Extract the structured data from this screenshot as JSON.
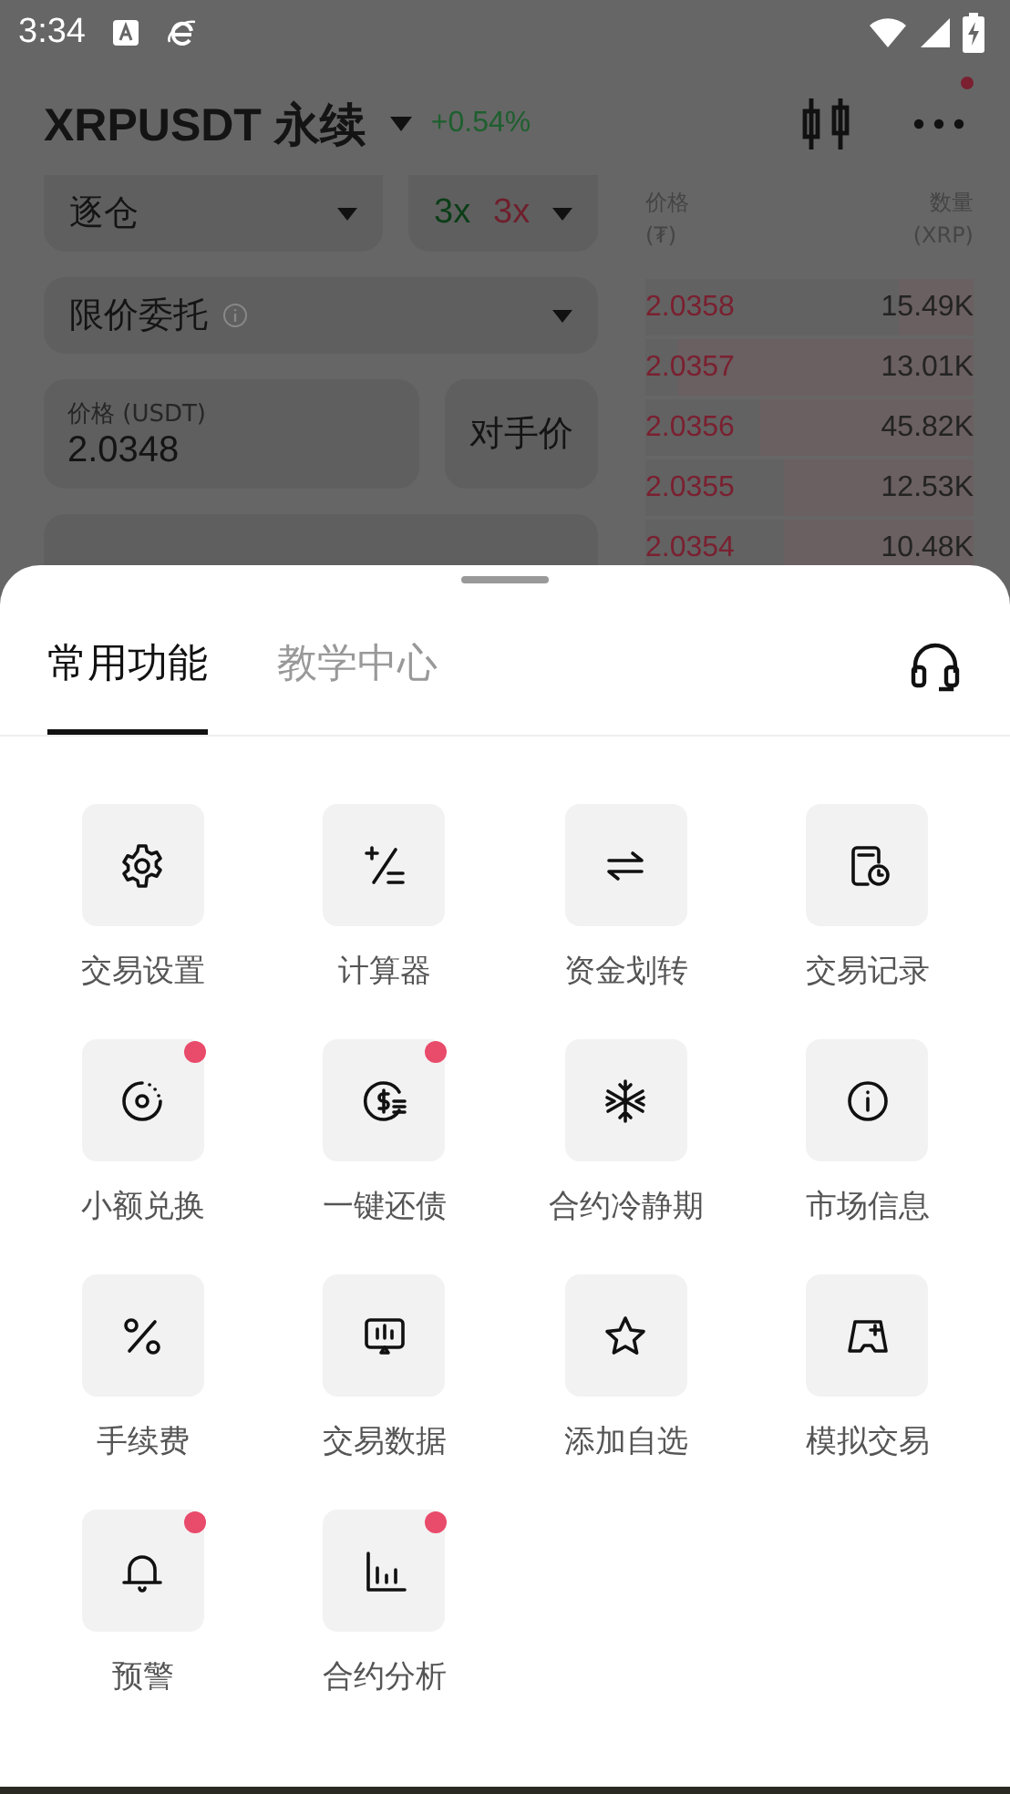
{
  "status_bar": {
    "time": "3:34"
  },
  "header": {
    "symbol": "XRPUSDT 永续",
    "change": "+0.54%",
    "more_badge": true
  },
  "order_form": {
    "margin_mode": "逐仓",
    "leverage_long": "3x",
    "leverage_short": "3x",
    "order_type": "限价委托",
    "price_label": "价格 (USDT)",
    "price_value": "2.0348",
    "counter_price_button": "对手价"
  },
  "order_book": {
    "price_header": "价格",
    "price_unit": "(₮)",
    "qty_header": "数量",
    "qty_unit": "(XRP)",
    "rows": [
      {
        "price": "2.0358",
        "qty": "15.49K",
        "level": 0.23
      },
      {
        "price": "2.0357",
        "qty": "13.01K",
        "level": 0.9
      },
      {
        "price": "2.0356",
        "qty": "45.82K",
        "level": 0.65
      },
      {
        "price": "2.0355",
        "qty": "12.53K",
        "level": 0.58
      },
      {
        "price": "2.0354",
        "qty": "10.48K",
        "level": 0.58
      }
    ]
  },
  "sheet": {
    "tabs": [
      {
        "label": "常用功能",
        "selected": true
      },
      {
        "label": "教学中心",
        "selected": false
      }
    ],
    "items": [
      {
        "label": "交易设置",
        "badge": false
      },
      {
        "label": "计算器",
        "badge": false
      },
      {
        "label": "资金划转",
        "badge": false
      },
      {
        "label": "交易记录",
        "badge": false
      },
      {
        "label": "小额兑换",
        "badge": true
      },
      {
        "label": "一键还债",
        "badge": true
      },
      {
        "label": "合约冷静期",
        "badge": false
      },
      {
        "label": "市场信息",
        "badge": false
      },
      {
        "label": "手续费",
        "badge": false
      },
      {
        "label": "交易数据",
        "badge": false
      },
      {
        "label": "添加自选",
        "badge": false
      },
      {
        "label": "模拟交易",
        "badge": false
      },
      {
        "label": "预警",
        "badge": true
      },
      {
        "label": "合约分析",
        "badge": true
      }
    ]
  }
}
